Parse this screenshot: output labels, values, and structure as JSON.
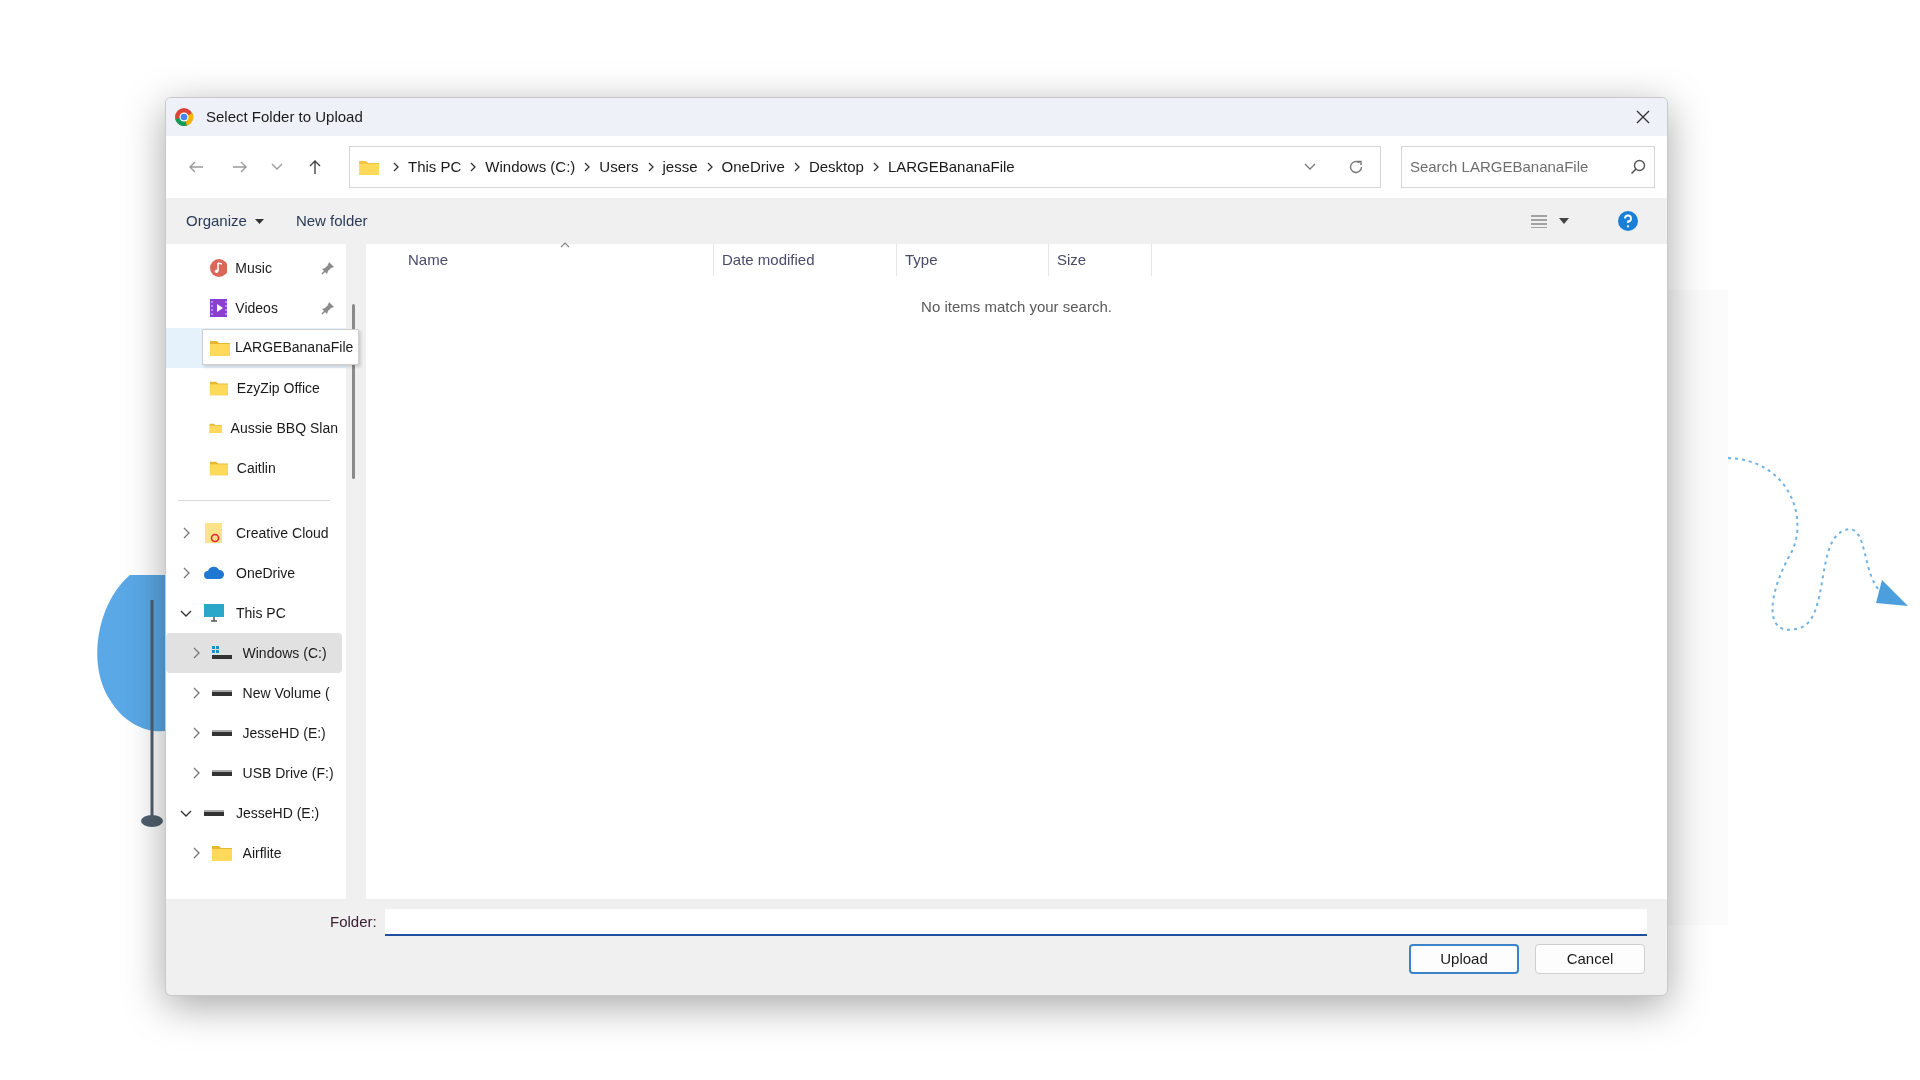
{
  "window": {
    "title": "Select Folder to Upload"
  },
  "address": {
    "crumbs": [
      "This PC",
      "Windows (C:)",
      "Users",
      "jesse",
      "OneDrive",
      "Desktop",
      "LARGEBananaFile"
    ]
  },
  "search": {
    "placeholder": "Search LARGEBananaFile"
  },
  "toolbar": {
    "organize": "Organize",
    "new_folder": "New folder"
  },
  "sidebar": {
    "quick_access": [
      {
        "label": "Music",
        "kind": "music",
        "pinned": true,
        "selected": false,
        "tooltip": false
      },
      {
        "label": "Videos",
        "kind": "videos",
        "pinned": true,
        "selected": false,
        "tooltip": false
      },
      {
        "label": "LARGEBananaFile",
        "kind": "folder",
        "pinned": false,
        "selected": true,
        "tooltip": true
      },
      {
        "label": "EzyZip Office",
        "kind": "folder",
        "pinned": false,
        "selected": false,
        "tooltip": false
      },
      {
        "label": "Aussie BBQ Slan",
        "kind": "folder",
        "pinned": false,
        "selected": false,
        "tooltip": false
      },
      {
        "label": "Caitlin",
        "kind": "folder",
        "pinned": false,
        "selected": false,
        "tooltip": false
      }
    ],
    "tree": [
      {
        "label": "Creative Cloud",
        "kind": "cloud-folder",
        "expanded": false,
        "selected": false
      },
      {
        "label": "OneDrive",
        "kind": "onedrive",
        "expanded": false,
        "selected": false
      },
      {
        "label": "This PC",
        "kind": "pc",
        "expanded": true,
        "selected": false,
        "children": [
          {
            "label": "Windows (C:)",
            "kind": "windows-drive",
            "expanded": false,
            "selected": true
          },
          {
            "label": "New Volume (",
            "kind": "drive",
            "expanded": false,
            "selected": false
          },
          {
            "label": "JesseHD (E:)",
            "kind": "drive",
            "expanded": false,
            "selected": false
          },
          {
            "label": "USB Drive (F:)",
            "kind": "drive",
            "expanded": false,
            "selected": false
          }
        ]
      },
      {
        "label": "JesseHD (E:)",
        "kind": "drive",
        "expanded": true,
        "selected": false,
        "children": [
          {
            "label": "Airflite",
            "kind": "folder",
            "expanded": false,
            "selected": false
          }
        ]
      }
    ]
  },
  "columns": [
    {
      "label": "Name",
      "sorted": true
    },
    {
      "label": "Date modified",
      "sorted": false
    },
    {
      "label": "Type",
      "sorted": false
    },
    {
      "label": "Size",
      "sorted": false
    }
  ],
  "empty_message": "No items match your search.",
  "folder_field": {
    "label": "Folder:"
  },
  "buttons": [
    {
      "label": "Upload",
      "default": true
    },
    {
      "label": "Cancel",
      "default": false
    }
  ]
}
